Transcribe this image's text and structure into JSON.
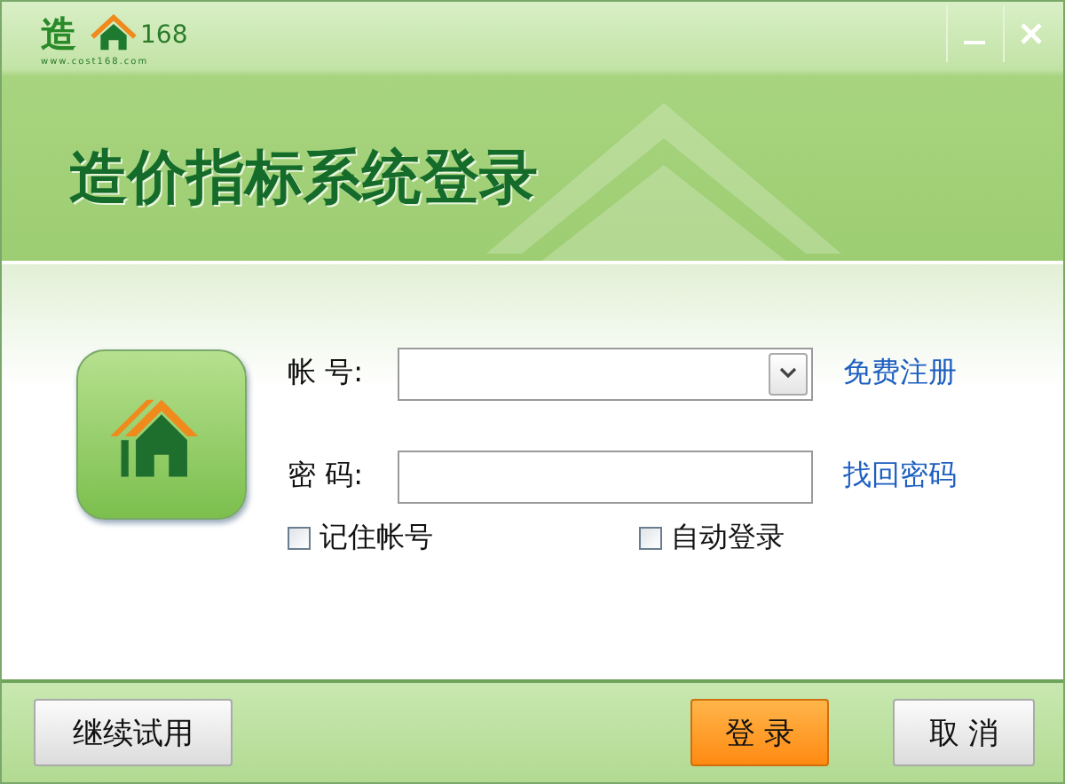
{
  "logo": {
    "mark": "造",
    "number": "168",
    "url": "www.cost168.com"
  },
  "title": "造价指标系统登录",
  "fields": [
    {
      "label": "帐 号:",
      "kind": "combo",
      "link": "免费注册"
    },
    {
      "label": "密 码:",
      "kind": "password",
      "link": "找回密码"
    }
  ],
  "options": [
    {
      "label": "记住帐号",
      "checked": false
    },
    {
      "label": "自动登录",
      "checked": false
    }
  ],
  "buttons": [
    {
      "label": "继续试用",
      "kind": "normal"
    },
    {
      "label": "登 录",
      "kind": "primary"
    },
    {
      "label": "取 消",
      "kind": "normal"
    }
  ]
}
